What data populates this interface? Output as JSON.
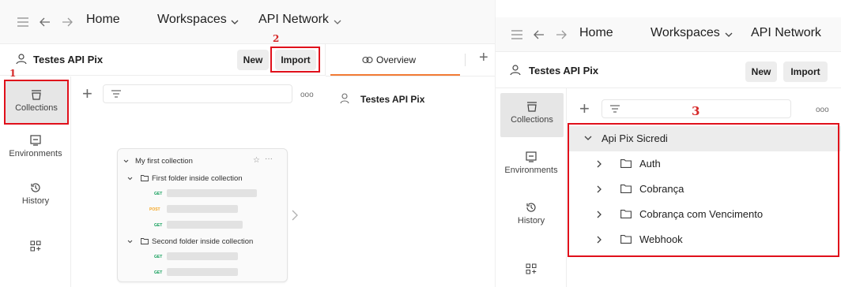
{
  "nav": {
    "home": "Home",
    "workspaces": "Workspaces",
    "api_network": "API Network"
  },
  "workspace": {
    "name": "Testes API Pix",
    "new_label": "New",
    "import_label": "Import"
  },
  "sidebar": {
    "items": [
      {
        "label": "Collections"
      },
      {
        "label": "Environments"
      },
      {
        "label": "History"
      }
    ]
  },
  "markers": {
    "one": "1",
    "two": "2",
    "three": "3"
  },
  "illustration": {
    "collection": "My first collection",
    "folder1": "First folder inside collection",
    "folder2": "Second folder inside collection",
    "get": "GET",
    "post": "POST"
  },
  "overview": {
    "tab_label": "Overview",
    "workspace_name": "Testes API Pix"
  },
  "tree": {
    "collection": "Api Pix Sicredi",
    "folders": [
      {
        "name": "Auth"
      },
      {
        "name": "Cobrança"
      },
      {
        "name": "Cobrança com Vencimento"
      },
      {
        "name": "Webhook"
      }
    ]
  },
  "colors": {
    "accent": "#f27b35",
    "annotation": "#e0101b",
    "get": "#0f9d58",
    "post": "#f5a623"
  }
}
